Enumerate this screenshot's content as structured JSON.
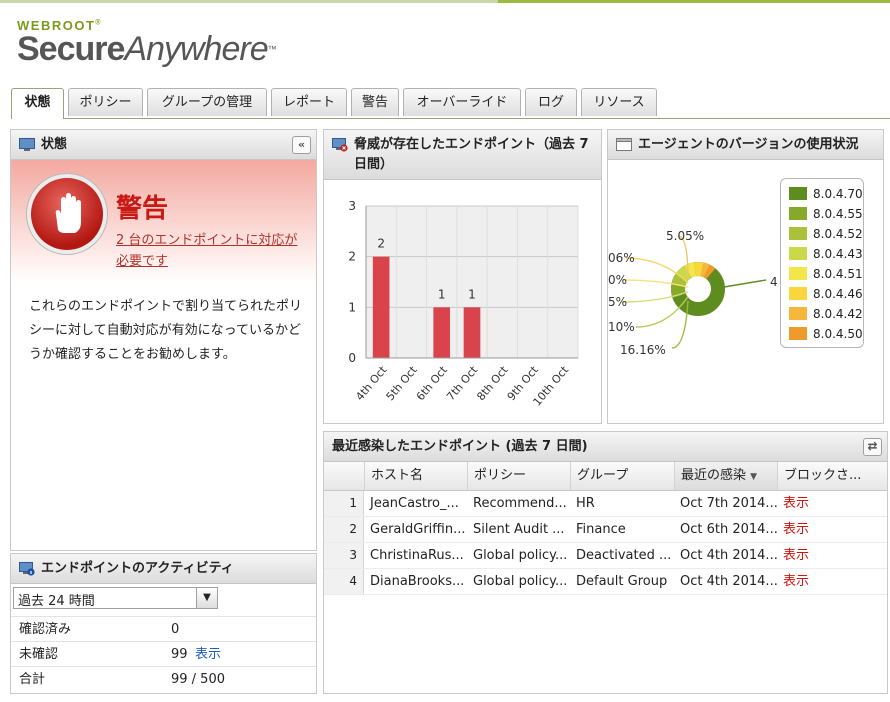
{
  "logo": {
    "brand": "WEBROOT",
    "brand_mark": "®",
    "product_bold": "Secure",
    "product_light": "Anywhere",
    "product_mark": "™"
  },
  "tabs": [
    {
      "label": "状態",
      "active": true
    },
    {
      "label": "ポリシー"
    },
    {
      "label": "グループの管理"
    },
    {
      "label": "レポート"
    },
    {
      "label": "警告"
    },
    {
      "label": "オーバーライド"
    },
    {
      "label": "ログ"
    },
    {
      "label": "リソース"
    }
  ],
  "status_panel": {
    "title": "状態",
    "collapse_label": "«",
    "alert_title": "警告",
    "alert_link": "2 台のエンドポイントに対応が必要です",
    "description": "これらのエンドポイントで割り当てられたポリシーに対して自動対応が有効になっているかどうか確認することをお勧めします。"
  },
  "activity_panel": {
    "title": "エンドポイントのアクティビティ",
    "period": "過去 24 時間",
    "rows": [
      {
        "label": "確認済み",
        "value": "0",
        "link": ""
      },
      {
        "label": "未確認",
        "value": "99",
        "link": "表示"
      },
      {
        "label": "合計",
        "value": "99 / 500",
        "link": ""
      }
    ]
  },
  "threat_panel": {
    "title_line1": "脅威が存在したエンドポイント（過去 7",
    "title_line2": "日間）"
  },
  "version_panel": {
    "title": "エージェントのバージョンの使用状況",
    "outside_label": "4"
  },
  "recent_panel": {
    "title": "最近感染したエンドポイント (過去 7 日間)",
    "columns": [
      "ホスト名",
      "ポリシー",
      "グループ",
      "最近の感染",
      "ブロックさ..."
    ],
    "rows": [
      {
        "num": "1",
        "host": "JeanCastro_...",
        "policy": "Recommend...",
        "group": "HR",
        "last": "Oct 7th 2014...",
        "block": "表示"
      },
      {
        "num": "2",
        "host": "GeraldGriffin...",
        "policy": "Silent Audit ...",
        "group": "Finance",
        "last": "Oct 6th 2014...",
        "block": "表示"
      },
      {
        "num": "3",
        "host": "ChristinaRus...",
        "policy": "Global policy...",
        "group": "Deactivated ...",
        "last": "Oct 4th 2014...",
        "block": "表示"
      },
      {
        "num": "4",
        "host": "DianaBrooks...",
        "policy": "Global policy...",
        "group": "Default Group",
        "last": "Oct 4th 2014...",
        "block": "表示"
      }
    ]
  },
  "colors": {
    "accent": "#9cbb3f",
    "bar": "#d9434b",
    "alert": "#c81912",
    "link": "#1f5fb8"
  },
  "chart_data": [
    {
      "type": "bar",
      "categories": [
        "4th Oct",
        "5th Oct",
        "6th Oct",
        "7th Oct",
        "8th Oct",
        "9th Oct",
        "10th Oct"
      ],
      "values": [
        2,
        0,
        1,
        1,
        0,
        0,
        0
      ],
      "data_labels": [
        "2",
        "",
        "1",
        "1",
        "",
        "",
        ""
      ],
      "title": "脅威が存在したエンドポイント（過去 7 日間）",
      "xlabel": "",
      "ylabel": "",
      "ylim": [
        0,
        3
      ],
      "yticks": [
        0,
        1,
        2,
        3
      ],
      "grid": true
    },
    {
      "type": "pie",
      "title": "エージェントのバージョンの使用状況",
      "categories": [
        "8.0.4.70",
        "8.0.4.55",
        "8.0.4.52",
        "8.0.4.43",
        "8.0.4.51",
        "8.0.4.46",
        "8.0.4.42",
        "8.0.4.50"
      ],
      "colors": [
        "#5e8c1e",
        "#86a92a",
        "#a9c23a",
        "#cbd84a",
        "#f2e64a",
        "#f8d63c",
        "#f5b83a",
        "#ef9b2c"
      ],
      "visible_slice_labels": [
        "5.05%",
        "06%",
        "0%",
        "5%",
        "10%",
        "16.16%"
      ],
      "legend": "right"
    }
  ]
}
